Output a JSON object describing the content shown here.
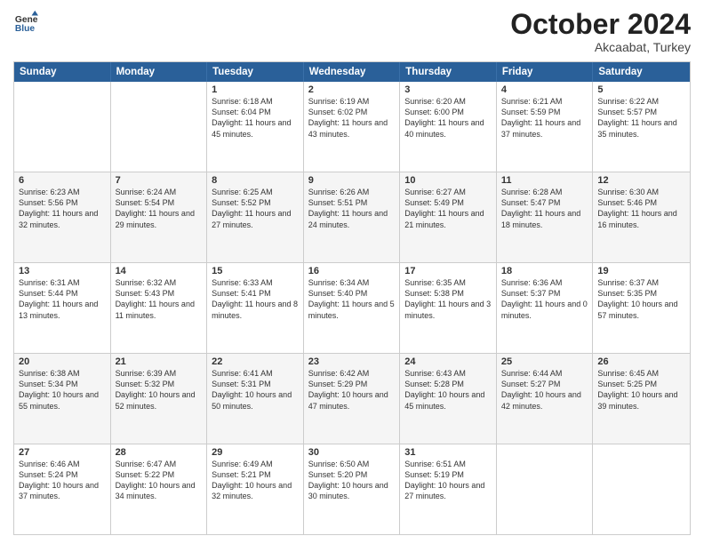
{
  "header": {
    "logo_line1": "General",
    "logo_line2": "Blue",
    "month": "October 2024",
    "location": "Akcaabat, Turkey"
  },
  "days_of_week": [
    "Sunday",
    "Monday",
    "Tuesday",
    "Wednesday",
    "Thursday",
    "Friday",
    "Saturday"
  ],
  "weeks": [
    [
      {
        "date": "",
        "sunrise": "",
        "sunset": "",
        "daylight": ""
      },
      {
        "date": "",
        "sunrise": "",
        "sunset": "",
        "daylight": ""
      },
      {
        "date": "1",
        "sunrise": "Sunrise: 6:18 AM",
        "sunset": "Sunset: 6:04 PM",
        "daylight": "Daylight: 11 hours and 45 minutes."
      },
      {
        "date": "2",
        "sunrise": "Sunrise: 6:19 AM",
        "sunset": "Sunset: 6:02 PM",
        "daylight": "Daylight: 11 hours and 43 minutes."
      },
      {
        "date": "3",
        "sunrise": "Sunrise: 6:20 AM",
        "sunset": "Sunset: 6:00 PM",
        "daylight": "Daylight: 11 hours and 40 minutes."
      },
      {
        "date": "4",
        "sunrise": "Sunrise: 6:21 AM",
        "sunset": "Sunset: 5:59 PM",
        "daylight": "Daylight: 11 hours and 37 minutes."
      },
      {
        "date": "5",
        "sunrise": "Sunrise: 6:22 AM",
        "sunset": "Sunset: 5:57 PM",
        "daylight": "Daylight: 11 hours and 35 minutes."
      }
    ],
    [
      {
        "date": "6",
        "sunrise": "Sunrise: 6:23 AM",
        "sunset": "Sunset: 5:56 PM",
        "daylight": "Daylight: 11 hours and 32 minutes."
      },
      {
        "date": "7",
        "sunrise": "Sunrise: 6:24 AM",
        "sunset": "Sunset: 5:54 PM",
        "daylight": "Daylight: 11 hours and 29 minutes."
      },
      {
        "date": "8",
        "sunrise": "Sunrise: 6:25 AM",
        "sunset": "Sunset: 5:52 PM",
        "daylight": "Daylight: 11 hours and 27 minutes."
      },
      {
        "date": "9",
        "sunrise": "Sunrise: 6:26 AM",
        "sunset": "Sunset: 5:51 PM",
        "daylight": "Daylight: 11 hours and 24 minutes."
      },
      {
        "date": "10",
        "sunrise": "Sunrise: 6:27 AM",
        "sunset": "Sunset: 5:49 PM",
        "daylight": "Daylight: 11 hours and 21 minutes."
      },
      {
        "date": "11",
        "sunrise": "Sunrise: 6:28 AM",
        "sunset": "Sunset: 5:47 PM",
        "daylight": "Daylight: 11 hours and 18 minutes."
      },
      {
        "date": "12",
        "sunrise": "Sunrise: 6:30 AM",
        "sunset": "Sunset: 5:46 PM",
        "daylight": "Daylight: 11 hours and 16 minutes."
      }
    ],
    [
      {
        "date": "13",
        "sunrise": "Sunrise: 6:31 AM",
        "sunset": "Sunset: 5:44 PM",
        "daylight": "Daylight: 11 hours and 13 minutes."
      },
      {
        "date": "14",
        "sunrise": "Sunrise: 6:32 AM",
        "sunset": "Sunset: 5:43 PM",
        "daylight": "Daylight: 11 hours and 11 minutes."
      },
      {
        "date": "15",
        "sunrise": "Sunrise: 6:33 AM",
        "sunset": "Sunset: 5:41 PM",
        "daylight": "Daylight: 11 hours and 8 minutes."
      },
      {
        "date": "16",
        "sunrise": "Sunrise: 6:34 AM",
        "sunset": "Sunset: 5:40 PM",
        "daylight": "Daylight: 11 hours and 5 minutes."
      },
      {
        "date": "17",
        "sunrise": "Sunrise: 6:35 AM",
        "sunset": "Sunset: 5:38 PM",
        "daylight": "Daylight: 11 hours and 3 minutes."
      },
      {
        "date": "18",
        "sunrise": "Sunrise: 6:36 AM",
        "sunset": "Sunset: 5:37 PM",
        "daylight": "Daylight: 11 hours and 0 minutes."
      },
      {
        "date": "19",
        "sunrise": "Sunrise: 6:37 AM",
        "sunset": "Sunset: 5:35 PM",
        "daylight": "Daylight: 10 hours and 57 minutes."
      }
    ],
    [
      {
        "date": "20",
        "sunrise": "Sunrise: 6:38 AM",
        "sunset": "Sunset: 5:34 PM",
        "daylight": "Daylight: 10 hours and 55 minutes."
      },
      {
        "date": "21",
        "sunrise": "Sunrise: 6:39 AM",
        "sunset": "Sunset: 5:32 PM",
        "daylight": "Daylight: 10 hours and 52 minutes."
      },
      {
        "date": "22",
        "sunrise": "Sunrise: 6:41 AM",
        "sunset": "Sunset: 5:31 PM",
        "daylight": "Daylight: 10 hours and 50 minutes."
      },
      {
        "date": "23",
        "sunrise": "Sunrise: 6:42 AM",
        "sunset": "Sunset: 5:29 PM",
        "daylight": "Daylight: 10 hours and 47 minutes."
      },
      {
        "date": "24",
        "sunrise": "Sunrise: 6:43 AM",
        "sunset": "Sunset: 5:28 PM",
        "daylight": "Daylight: 10 hours and 45 minutes."
      },
      {
        "date": "25",
        "sunrise": "Sunrise: 6:44 AM",
        "sunset": "Sunset: 5:27 PM",
        "daylight": "Daylight: 10 hours and 42 minutes."
      },
      {
        "date": "26",
        "sunrise": "Sunrise: 6:45 AM",
        "sunset": "Sunset: 5:25 PM",
        "daylight": "Daylight: 10 hours and 39 minutes."
      }
    ],
    [
      {
        "date": "27",
        "sunrise": "Sunrise: 6:46 AM",
        "sunset": "Sunset: 5:24 PM",
        "daylight": "Daylight: 10 hours and 37 minutes."
      },
      {
        "date": "28",
        "sunrise": "Sunrise: 6:47 AM",
        "sunset": "Sunset: 5:22 PM",
        "daylight": "Daylight: 10 hours and 34 minutes."
      },
      {
        "date": "29",
        "sunrise": "Sunrise: 6:49 AM",
        "sunset": "Sunset: 5:21 PM",
        "daylight": "Daylight: 10 hours and 32 minutes."
      },
      {
        "date": "30",
        "sunrise": "Sunrise: 6:50 AM",
        "sunset": "Sunset: 5:20 PM",
        "daylight": "Daylight: 10 hours and 30 minutes."
      },
      {
        "date": "31",
        "sunrise": "Sunrise: 6:51 AM",
        "sunset": "Sunset: 5:19 PM",
        "daylight": "Daylight: 10 hours and 27 minutes."
      },
      {
        "date": "",
        "sunrise": "",
        "sunset": "",
        "daylight": ""
      },
      {
        "date": "",
        "sunrise": "",
        "sunset": "",
        "daylight": ""
      }
    ]
  ]
}
